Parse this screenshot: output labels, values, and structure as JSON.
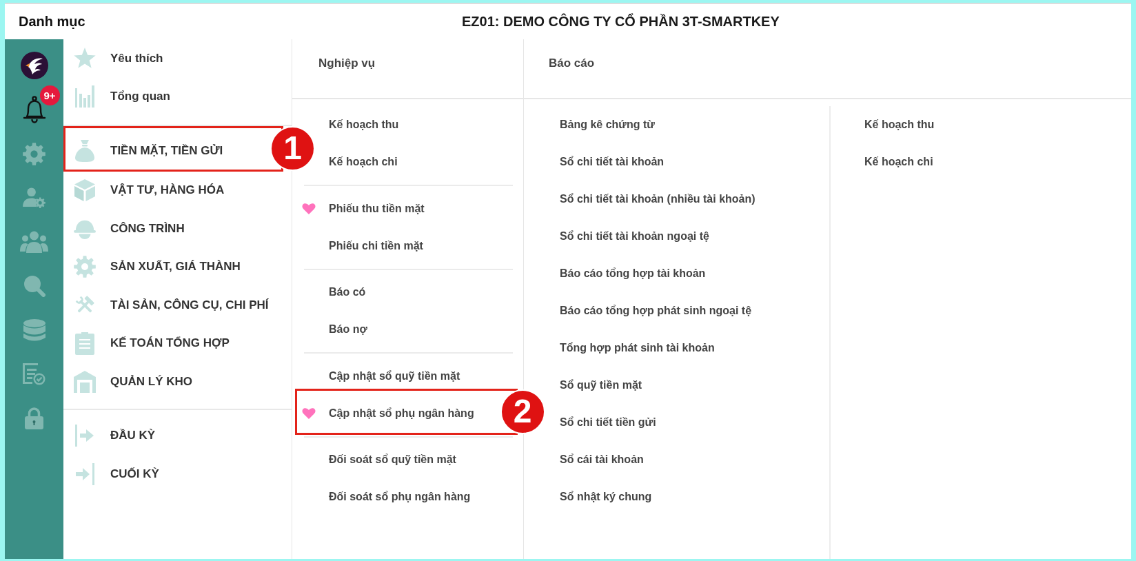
{
  "header": {
    "title": "Danh mục",
    "company": "EZ01: DEMO CÔNG TY CỔ PHẦN 3T-SMARTKEY"
  },
  "rail": {
    "notification_count": "9+"
  },
  "categories": {
    "groups": [
      {
        "items": [
          {
            "label": "Yêu thích"
          },
          {
            "label": "Tổng quan"
          }
        ]
      },
      {
        "items": [
          {
            "label": "TIỀN MẶT, TIỀN GỬI",
            "callout": "1"
          },
          {
            "label": "VẬT TƯ, HÀNG HÓA"
          },
          {
            "label": "CÔNG TRÌNH"
          },
          {
            "label": "SẢN XUẤT, GIÁ THÀNH"
          },
          {
            "label": "TÀI SẢN, CÔNG CỤ, CHI PHÍ"
          },
          {
            "label": "KẾ TOÁN TỔNG HỢP"
          },
          {
            "label": "QUẢN LÝ KHO"
          }
        ]
      },
      {
        "items": [
          {
            "label": "ĐẦU KỲ"
          },
          {
            "label": "CUỐI KỲ"
          }
        ]
      }
    ]
  },
  "operations": {
    "heading": "Nghiệp vụ",
    "groups": [
      {
        "items": [
          {
            "label": "Kế hoạch thu",
            "favorite": false
          },
          {
            "label": "Kế hoạch chi",
            "favorite": false
          }
        ]
      },
      {
        "items": [
          {
            "label": "Phiếu thu tiền mặt",
            "favorite": true
          },
          {
            "label": "Phiếu chi tiền mặt",
            "favorite": false
          }
        ]
      },
      {
        "items": [
          {
            "label": "Báo có",
            "favorite": false
          },
          {
            "label": "Báo nợ",
            "favorite": false
          }
        ]
      },
      {
        "items": [
          {
            "label": "Cập nhật sổ quỹ tiền mặt",
            "favorite": false
          },
          {
            "label": "Cập nhật sổ phụ ngân hàng",
            "favorite": true,
            "callout": "2"
          }
        ]
      },
      {
        "items": [
          {
            "label": "Đối soát sổ quỹ tiền mặt",
            "favorite": false
          },
          {
            "label": "Đối soát sổ phụ ngân hàng",
            "favorite": false
          }
        ]
      }
    ]
  },
  "reports": {
    "heading": "Báo cáo",
    "columns": [
      {
        "items": [
          "Bảng kê chứng từ",
          "Sổ chi tiết tài khoản",
          "Sổ chi tiết tài khoản (nhiều tài khoản)",
          "Sổ chi tiết tài khoản ngoại tệ",
          "Báo cáo tổng hợp tài khoản",
          "Báo cáo tổng hợp phát sinh ngoại tệ",
          "Tổng hợp phát sinh tài khoản",
          "Sổ quỹ tiền mặt",
          "Sổ chi tiết tiền gửi",
          "Sổ cái tài khoản",
          "Sổ nhật ký chung"
        ]
      },
      {
        "items": [
          "Kế hoạch thu",
          "Kế hoạch chi"
        ]
      }
    ]
  }
}
